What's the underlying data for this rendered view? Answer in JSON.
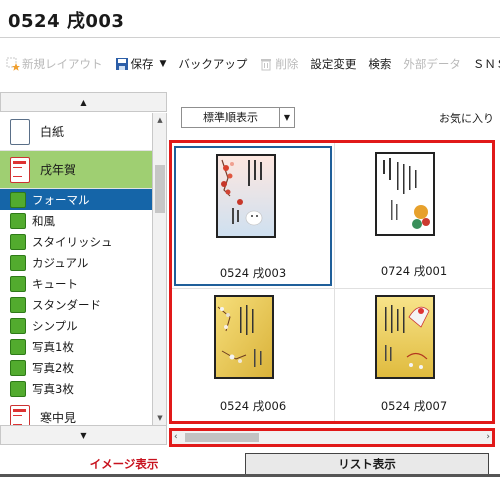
{
  "window": {
    "title": "0524 戌003"
  },
  "toolbar": {
    "new_layout": "新規レイアウト",
    "save": "保存",
    "backup": "バックアップ",
    "delete": "削除",
    "settings": "設定変更",
    "search": "検索",
    "external_data": "外部データ",
    "sns": "ＳＮＳ"
  },
  "sidebar": {
    "categories": [
      {
        "label": "白紙",
        "icon": "blank-page-icon"
      },
      {
        "label": "戌年賀",
        "icon": "card-template-icon",
        "selected": true
      },
      {
        "label": "寒中見",
        "icon": "card-template-icon"
      }
    ],
    "items": [
      {
        "label": "フォーマル",
        "selected": true
      },
      {
        "label": "和風"
      },
      {
        "label": "スタイリッシュ"
      },
      {
        "label": "カジュアル"
      },
      {
        "label": "キュート"
      },
      {
        "label": "スタンダード"
      },
      {
        "label": "シンプル"
      },
      {
        "label": "写真1枚"
      },
      {
        "label": "写真2枚"
      },
      {
        "label": "写真3枚"
      }
    ]
  },
  "main": {
    "sort_label": "標準順表示",
    "favorites_label": "お気に入り",
    "thumbnails": [
      {
        "label": "0524 戌003",
        "selected": true
      },
      {
        "label": "0724 戌001"
      },
      {
        "label": "0524 戌006"
      },
      {
        "label": "0524 戌007"
      }
    ]
  },
  "tabs": {
    "image_view": "イメージ表示",
    "list_view": "リスト表示"
  },
  "colors": {
    "accent_red": "#e11919",
    "selected_blue": "#1565a8",
    "category_green": "#9fcf72"
  }
}
